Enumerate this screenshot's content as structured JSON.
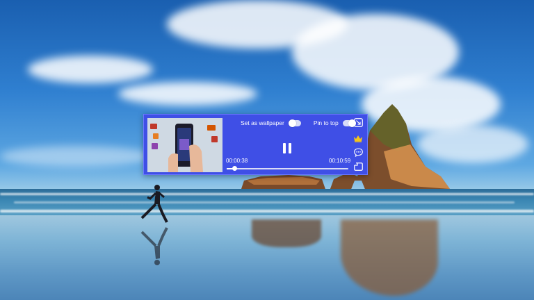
{
  "desktop": {
    "wallpaper": "beach with sea stacks and runner"
  },
  "player": {
    "set_wallpaper_label": "Set as wallpaper",
    "set_wallpaper_on": false,
    "pin_to_top_label": "Pin to top",
    "pin_to_top_on": true,
    "current_time": "00:00:38",
    "total_time": "00:10:59",
    "progress": 0.06,
    "icons": {
      "collapse": "collapse-icon",
      "premium": "crown-icon",
      "feedback": "chat-bubble-icon",
      "minimize": "minimize-window-icon",
      "pause": "pause-icon"
    },
    "accent": "#3f4fe6"
  }
}
